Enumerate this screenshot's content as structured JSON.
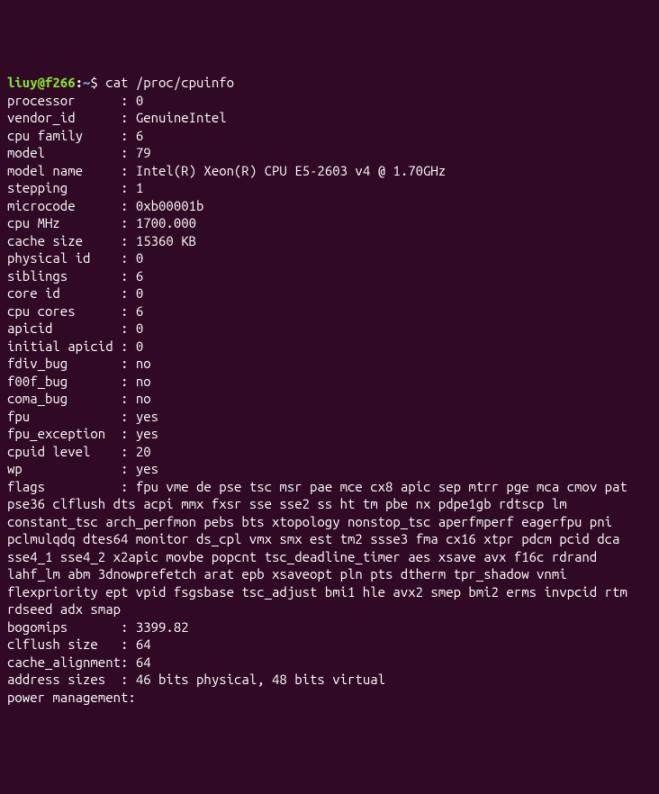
{
  "prompt": {
    "user_host": "liuy@f266",
    "colon": ":",
    "path": "~",
    "dollar": "$ "
  },
  "command": "cat /proc/cpuinfo",
  "fields": [
    {
      "key": "processor",
      "val": "0"
    },
    {
      "key": "vendor_id",
      "val": "GenuineIntel"
    },
    {
      "key": "cpu family",
      "val": "6"
    },
    {
      "key": "model",
      "val": "79"
    },
    {
      "key": "model name",
      "val": "Intel(R) Xeon(R) CPU E5-2603 v4 @ 1.70GHz"
    },
    {
      "key": "stepping",
      "val": "1"
    },
    {
      "key": "microcode",
      "val": "0xb00001b"
    },
    {
      "key": "cpu MHz",
      "val": "1700.000"
    },
    {
      "key": "cache size",
      "val": "15360 KB"
    },
    {
      "key": "physical id",
      "val": "0"
    },
    {
      "key": "siblings",
      "val": "6"
    },
    {
      "key": "core id",
      "val": "0"
    },
    {
      "key": "cpu cores",
      "val": "6"
    },
    {
      "key": "apicid",
      "val": "0"
    },
    {
      "key": "initial apicid",
      "val": "0"
    },
    {
      "key": "fdiv_bug",
      "val": "no"
    },
    {
      "key": "f00f_bug",
      "val": "no"
    },
    {
      "key": "coma_bug",
      "val": "no"
    },
    {
      "key": "fpu",
      "val": "yes"
    },
    {
      "key": "fpu_exception",
      "val": "yes"
    },
    {
      "key": "cpuid level",
      "val": "20"
    },
    {
      "key": "wp",
      "val": "yes"
    }
  ],
  "flags": {
    "key": "flags",
    "val": "fpu vme de pse tsc msr pae mce cx8 apic sep mtrr pge mca cmov pat pse36 clflush dts acpi mmx fxsr sse sse2 ss ht tm pbe nx pdpe1gb rdtscp lm constant_tsc arch_perfmon pebs bts xtopology nonstop_tsc aperfmperf eagerfpu pni pclmulqdq dtes64 monitor ds_cpl vmx smx est tm2 ssse3 fma cx16 xtpr pdcm pcid dca sse4_1 sse4_2 x2apic movbe popcnt tsc_deadline_timer aes xsave avx f16c rdrand lahf_lm abm 3dnowprefetch arat epb xsaveopt pln pts dtherm tpr_shadow vnmi flexpriority ept vpid fsgsbase tsc_adjust bmi1 hle avx2 smep bmi2 erms invpcid rtm rdseed adx smap"
  },
  "fields2": [
    {
      "key": "bogomips",
      "val": "3399.82"
    },
    {
      "key": "clflush size",
      "val": "64"
    },
    {
      "key": "cache_alignment",
      "val": "64"
    },
    {
      "key": "address sizes",
      "val": "46 bits physical, 48 bits virtual"
    },
    {
      "key": "power management",
      "val": "",
      "nosep": true
    }
  ],
  "separator": ": "
}
